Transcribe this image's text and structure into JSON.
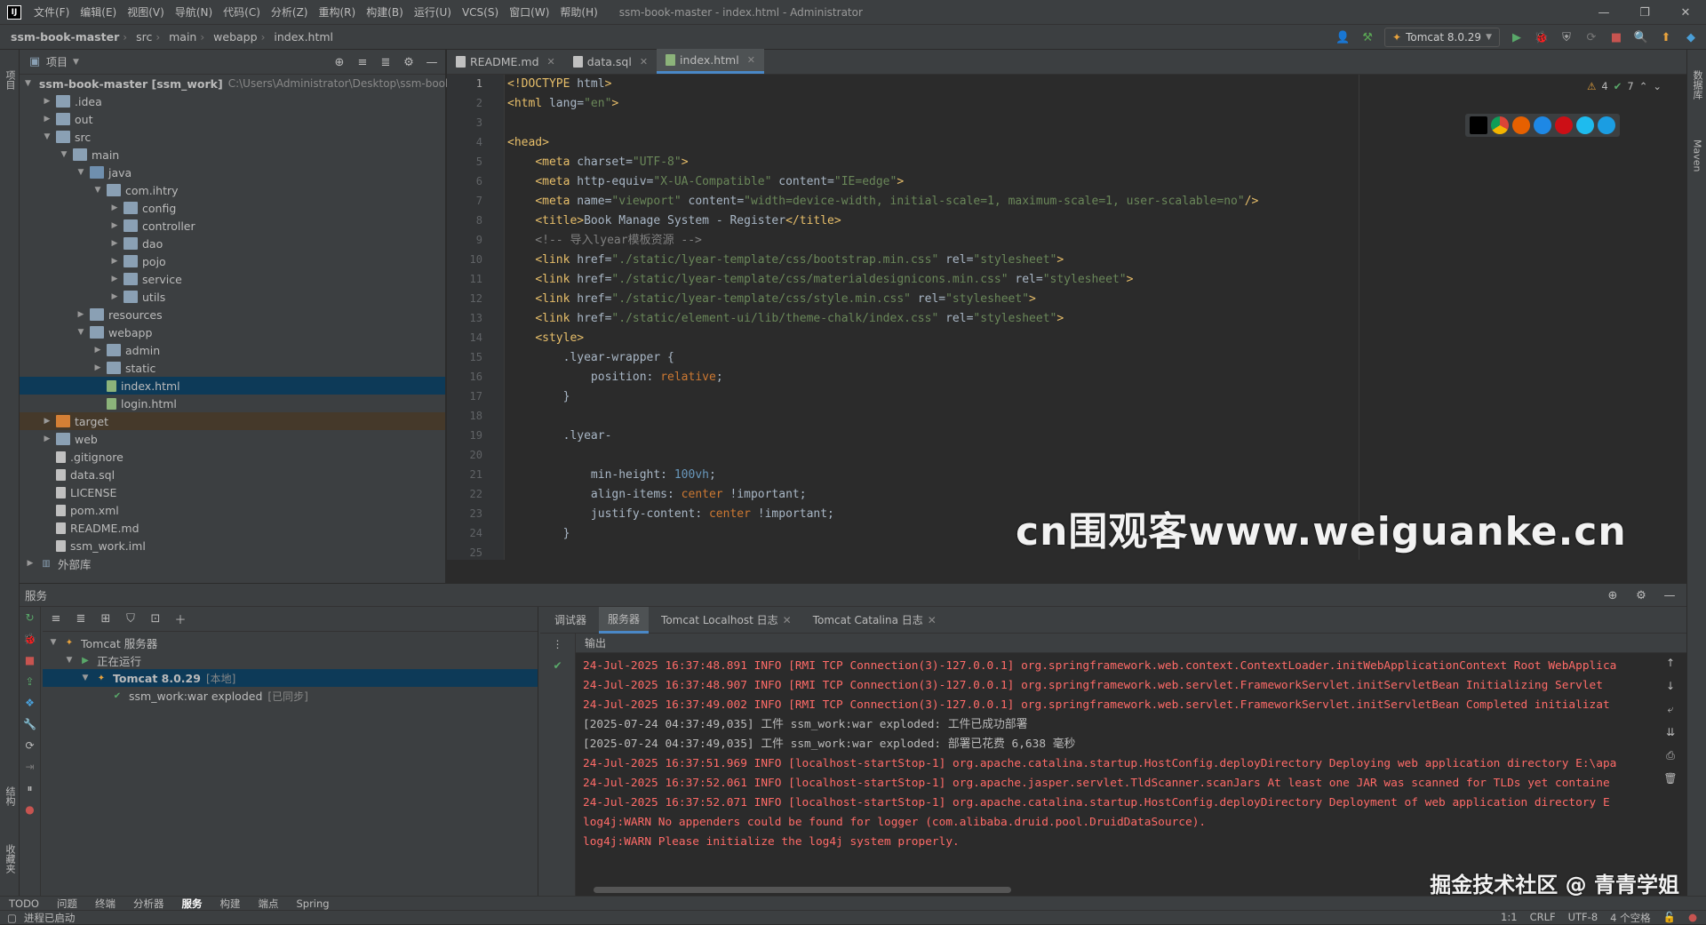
{
  "menu": {
    "items": [
      "文件(F)",
      "编辑(E)",
      "视图(V)",
      "导航(N)",
      "代码(C)",
      "分析(Z)",
      "重构(R)",
      "构建(B)",
      "运行(U)",
      "VCS(S)",
      "窗口(W)",
      "帮助(H)"
    ],
    "window_title": "ssm-book-master - index.html - Administrator",
    "logo_text": "IJ"
  },
  "breadcrumbs": [
    "ssm-book-master",
    "src",
    "main",
    "webapp",
    "index.html"
  ],
  "run_config": "Tomcat 8.0.29",
  "project_panel": {
    "title": "项目",
    "tree": [
      {
        "label": "ssm-book-master [ssm_work]",
        "path": "C:\\Users\\Administrator\\Desktop\\ssm-book",
        "depth": 0,
        "open": true,
        "kind": "folder"
      },
      {
        "label": ".idea",
        "depth": 1,
        "open": false,
        "kind": "folder"
      },
      {
        "label": "out",
        "depth": 1,
        "open": false,
        "kind": "folder"
      },
      {
        "label": "src",
        "depth": 1,
        "open": true,
        "kind": "folder"
      },
      {
        "label": "main",
        "depth": 2,
        "open": true,
        "kind": "folder"
      },
      {
        "label": "java",
        "depth": 3,
        "open": true,
        "kind": "src"
      },
      {
        "label": "com.ihtry",
        "depth": 4,
        "open": true,
        "kind": "folder"
      },
      {
        "label": "config",
        "depth": 5,
        "open": false,
        "kind": "folder"
      },
      {
        "label": "controller",
        "depth": 5,
        "open": false,
        "kind": "folder"
      },
      {
        "label": "dao",
        "depth": 5,
        "open": false,
        "kind": "folder"
      },
      {
        "label": "pojo",
        "depth": 5,
        "open": false,
        "kind": "folder"
      },
      {
        "label": "service",
        "depth": 5,
        "open": false,
        "kind": "folder"
      },
      {
        "label": "utils",
        "depth": 5,
        "open": false,
        "kind": "folder"
      },
      {
        "label": "resources",
        "depth": 3,
        "open": false,
        "kind": "folder"
      },
      {
        "label": "webapp",
        "depth": 3,
        "open": true,
        "kind": "folder"
      },
      {
        "label": "admin",
        "depth": 4,
        "open": false,
        "kind": "folder"
      },
      {
        "label": "static",
        "depth": 4,
        "open": false,
        "kind": "folder"
      },
      {
        "label": "index.html",
        "depth": 4,
        "kind": "html",
        "selected": true
      },
      {
        "label": "login.html",
        "depth": 4,
        "kind": "html"
      },
      {
        "label": "target",
        "depth": 1,
        "open": false,
        "kind": "orange",
        "highlight": true
      },
      {
        "label": "web",
        "depth": 1,
        "open": false,
        "kind": "folder"
      },
      {
        "label": ".gitignore",
        "depth": 1,
        "kind": "file"
      },
      {
        "label": "data.sql",
        "depth": 1,
        "kind": "file"
      },
      {
        "label": "LICENSE",
        "depth": 1,
        "kind": "file"
      },
      {
        "label": "pom.xml",
        "depth": 1,
        "kind": "file"
      },
      {
        "label": "README.md",
        "depth": 1,
        "kind": "file"
      },
      {
        "label": "ssm_work.iml",
        "depth": 1,
        "kind": "file"
      },
      {
        "label": "外部库",
        "depth": 0,
        "open": false,
        "kind": "lib"
      }
    ]
  },
  "editor_tabs": [
    {
      "label": "README.md",
      "active": false
    },
    {
      "label": "data.sql",
      "active": false
    },
    {
      "label": "index.html",
      "active": true
    }
  ],
  "inspections": {
    "warnings": "4",
    "ok": "7"
  },
  "code_lines": [
    "<!DOCTYPE html>",
    "<html lang=\"en\">",
    "",
    "<head>",
    "    <meta charset=\"UTF-8\">",
    "    <meta http-equiv=\"X-UA-Compatible\" content=\"IE=edge\">",
    "    <meta name=\"viewport\" content=\"width=device-width, initial-scale=1, maximum-scale=1, user-scalable=no\"/>",
    "    <title>Book Manage System - Register</title>",
    "    <!-- 导入lyear模板资源 -->",
    "    <link href=\"./static/lyear-template/css/bootstrap.min.css\" rel=\"stylesheet\">",
    "    <link href=\"./static/lyear-template/css/materialdesignicons.min.css\" rel=\"stylesheet\">",
    "    <link href=\"./static/lyear-template/css/style.min.css\" rel=\"stylesheet\">",
    "    <link href=\"./static/element-ui/lib/theme-chalk/index.css\" rel=\"stylesheet\">",
    "    <style>",
    "        .lyear-wrapper {",
    "            position: relative;",
    "        }",
    "",
    "        .lyear-",
    "            ",
    "            min-height: 100vh;",
    "            align-items: center !important;",
    "            justify-content: center !important;",
    "        }",
    ""
  ],
  "watermark": "cn围观客www.weiguanke.cn",
  "services": {
    "title": "服务",
    "tree": [
      {
        "label": "Tomcat 服务器",
        "depth": 0
      },
      {
        "label": "正在运行",
        "depth": 1
      },
      {
        "label": "Tomcat 8.0.29",
        "suffix": "[本地]",
        "depth": 2,
        "selected": true
      },
      {
        "label": "ssm_work:war exploded",
        "suffix": "[已同步]",
        "depth": 3
      }
    ],
    "output_tabs": [
      {
        "label": "调试器",
        "active": false
      },
      {
        "label": "服务器",
        "active": true
      },
      {
        "label": "Tomcat Localhost 日志",
        "active": false
      },
      {
        "label": "Tomcat Catalina 日志",
        "active": false
      }
    ],
    "output_header": "输出",
    "log_lines": [
      {
        "text": "24-Jul-2025 16:37:48.891 INFO [RMI TCP Connection(3)-127.0.0.1] org.springframework.web.context.ContextLoader.initWebApplicationContext Root WebApplica",
        "err": true
      },
      {
        "text": "24-Jul-2025 16:37:48.907 INFO [RMI TCP Connection(3)-127.0.0.1] org.springframework.web.servlet.FrameworkServlet.initServletBean Initializing Servlet",
        "err": true
      },
      {
        "text": "24-Jul-2025 16:37:49.002 INFO [RMI TCP Connection(3)-127.0.0.1] org.springframework.web.servlet.FrameworkServlet.initServletBean Completed initializat",
        "err": true
      },
      {
        "text": "[2025-07-24 04:37:49,035] 工件 ssm_work:war exploded: 工件已成功部署",
        "err": false
      },
      {
        "text": "[2025-07-24 04:37:49,035] 工件 ssm_work:war exploded: 部署已花费 6,638 毫秒",
        "err": false
      },
      {
        "text": "24-Jul-2025 16:37:51.969 INFO [localhost-startStop-1] org.apache.catalina.startup.HostConfig.deployDirectory Deploying web application directory E:\\apa",
        "err": true
      },
      {
        "text": "24-Jul-2025 16:37:52.061 INFO [localhost-startStop-1] org.apache.jasper.servlet.TldScanner.scanJars At least one JAR was scanned for TLDs yet containe",
        "err": true
      },
      {
        "text": "24-Jul-2025 16:37:52.071 INFO [localhost-startStop-1] org.apache.catalina.startup.HostConfig.deployDirectory Deployment of web application directory E",
        "err": true
      },
      {
        "text": "log4j:WARN No appenders could be found for logger (com.alibaba.druid.pool.DruidDataSource).",
        "err": true
      },
      {
        "text": "log4j:WARN Please initialize the log4j system properly.",
        "err": true
      }
    ]
  },
  "bottom_tabs": [
    {
      "label": "TODO",
      "active": false
    },
    {
      "label": "问题",
      "active": false
    },
    {
      "label": "终端",
      "active": false
    },
    {
      "label": "分析器",
      "active": false
    },
    {
      "label": "服务",
      "active": true
    },
    {
      "label": "构建",
      "active": false
    },
    {
      "label": "端点",
      "active": false
    },
    {
      "label": "Spring",
      "active": false
    }
  ],
  "status": {
    "message": "进程已启动",
    "position": "1:1",
    "line_sep": "CRLF",
    "encoding": "UTF-8",
    "indent": "4 个空格"
  },
  "left_strip_tabs": [
    "项目",
    "结构",
    "收藏夹"
  ],
  "right_strip_tabs": [
    "数据库",
    "Maven"
  ],
  "corner_watermark": "掘金技术社区 @ 青青学姐",
  "colors": {
    "accent": "#4a88c7",
    "selection": "#0d3a58",
    "error_text": "#ff6b68"
  }
}
